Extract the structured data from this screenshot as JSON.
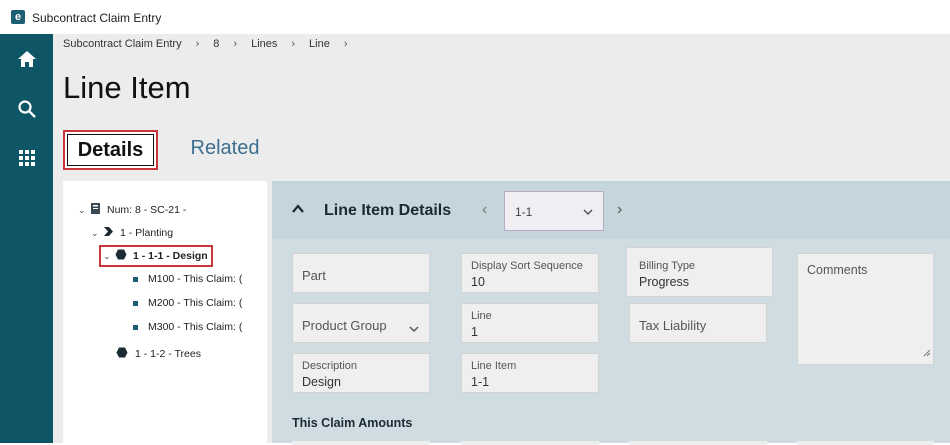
{
  "window": {
    "title": "Subcontract Claim Entry",
    "logo_letter": "e"
  },
  "nav": {
    "icons": [
      "home-icon",
      "search-icon",
      "apps-grid-icon"
    ]
  },
  "breadcrumb": {
    "items": [
      "Subcontract Claim Entry",
      "8",
      "Lines",
      "Line",
      ""
    ]
  },
  "page": {
    "title": "Line Item"
  },
  "tabs": {
    "details": "Details",
    "related": "Related"
  },
  "tree": {
    "root": "Num: 8 - SC-21 -",
    "planting": "1 - Planting",
    "design": "1 - 1-1 - Design",
    "children": [
      "M100 - This Claim: (",
      "M200 - This Claim: (",
      "M300 - This Claim: ("
    ],
    "trees": "1 - 1-2 - Trees"
  },
  "details": {
    "section_title": "Line Item Details",
    "line_selector": "1-1",
    "fields": {
      "part_label": "Part",
      "display_sort_label": "Display Sort Sequence",
      "display_sort_value": "10",
      "billing_type_label": "Billing Type",
      "billing_type_value": "Progress",
      "comments_label": "Comments",
      "product_group_label": "Product Group",
      "line_label": "Line",
      "line_value": "1",
      "tax_liability_label": "Tax Liability",
      "description_label": "Description",
      "description_value": "Design",
      "line_item_label": "Line Item",
      "line_item_value": "1-1"
    },
    "subsection_title": "This Claim Amounts"
  },
  "colors": {
    "nav_bg": "#0e5565",
    "highlight": "#c8363b",
    "panel_bg": "#cfdde3",
    "link": "#3d6f8f"
  }
}
